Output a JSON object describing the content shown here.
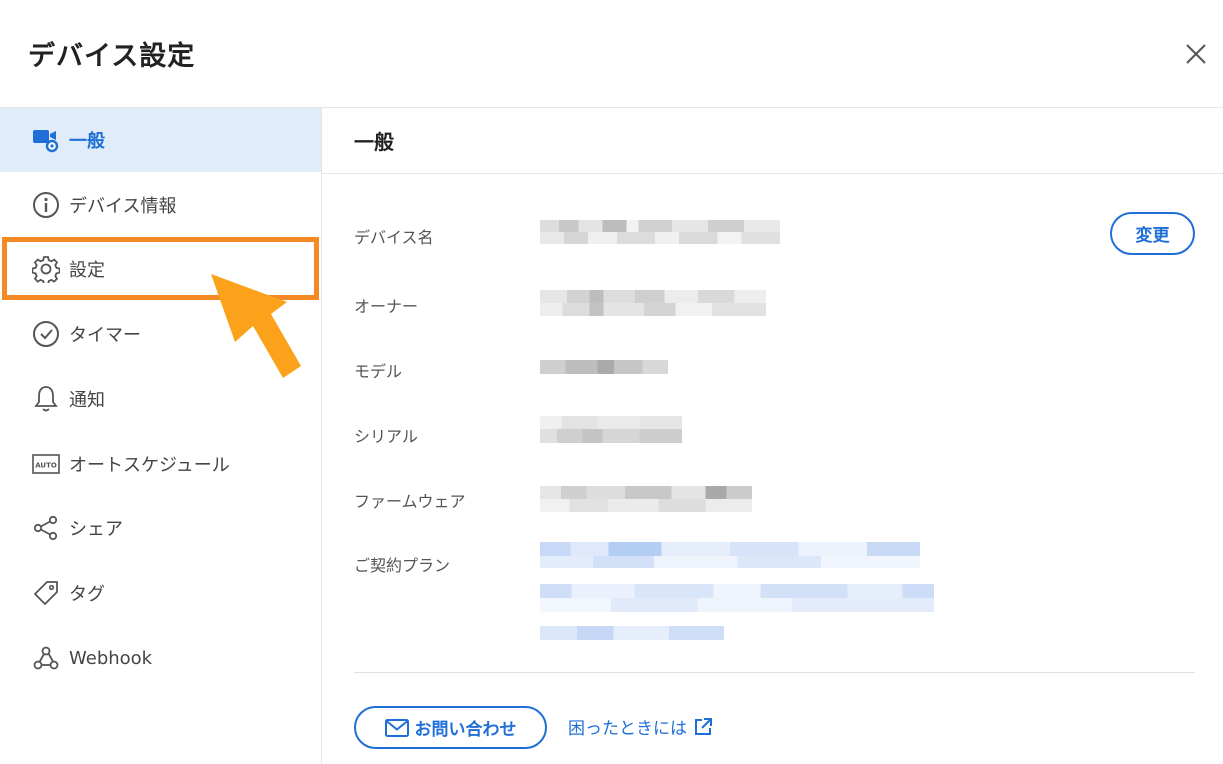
{
  "header": {
    "title": "デバイス設定"
  },
  "sidebar": {
    "items": [
      {
        "label": "一般",
        "icon": "device-settings-icon",
        "active": true
      },
      {
        "label": "デバイス情報",
        "icon": "info-icon"
      },
      {
        "label": "設定",
        "icon": "gear-icon"
      },
      {
        "label": "タイマー",
        "icon": "clock-icon"
      },
      {
        "label": "通知",
        "icon": "bell-icon"
      },
      {
        "label": "オートスケジュール",
        "icon": "auto-icon"
      },
      {
        "label": "シェア",
        "icon": "share-icon"
      },
      {
        "label": "タグ",
        "icon": "tag-icon"
      },
      {
        "label": "Webhook",
        "icon": "webhook-icon"
      }
    ]
  },
  "main": {
    "title": "一般",
    "fields": [
      {
        "label": "デバイス名"
      },
      {
        "label": "オーナー"
      },
      {
        "label": "モデル"
      },
      {
        "label": "シリアル"
      },
      {
        "label": "ファームウェア"
      },
      {
        "label": "ご契約プラン"
      }
    ],
    "change_label": "変更",
    "contact_label": "お問い合わせ",
    "help_label": "困ったときには"
  },
  "auto_icon_text": "AUTO",
  "colors": {
    "accent": "#1f6fd6",
    "active_bg": "#e1ecfb",
    "highlight": "#f58a24",
    "arrow": "#fba21a"
  }
}
